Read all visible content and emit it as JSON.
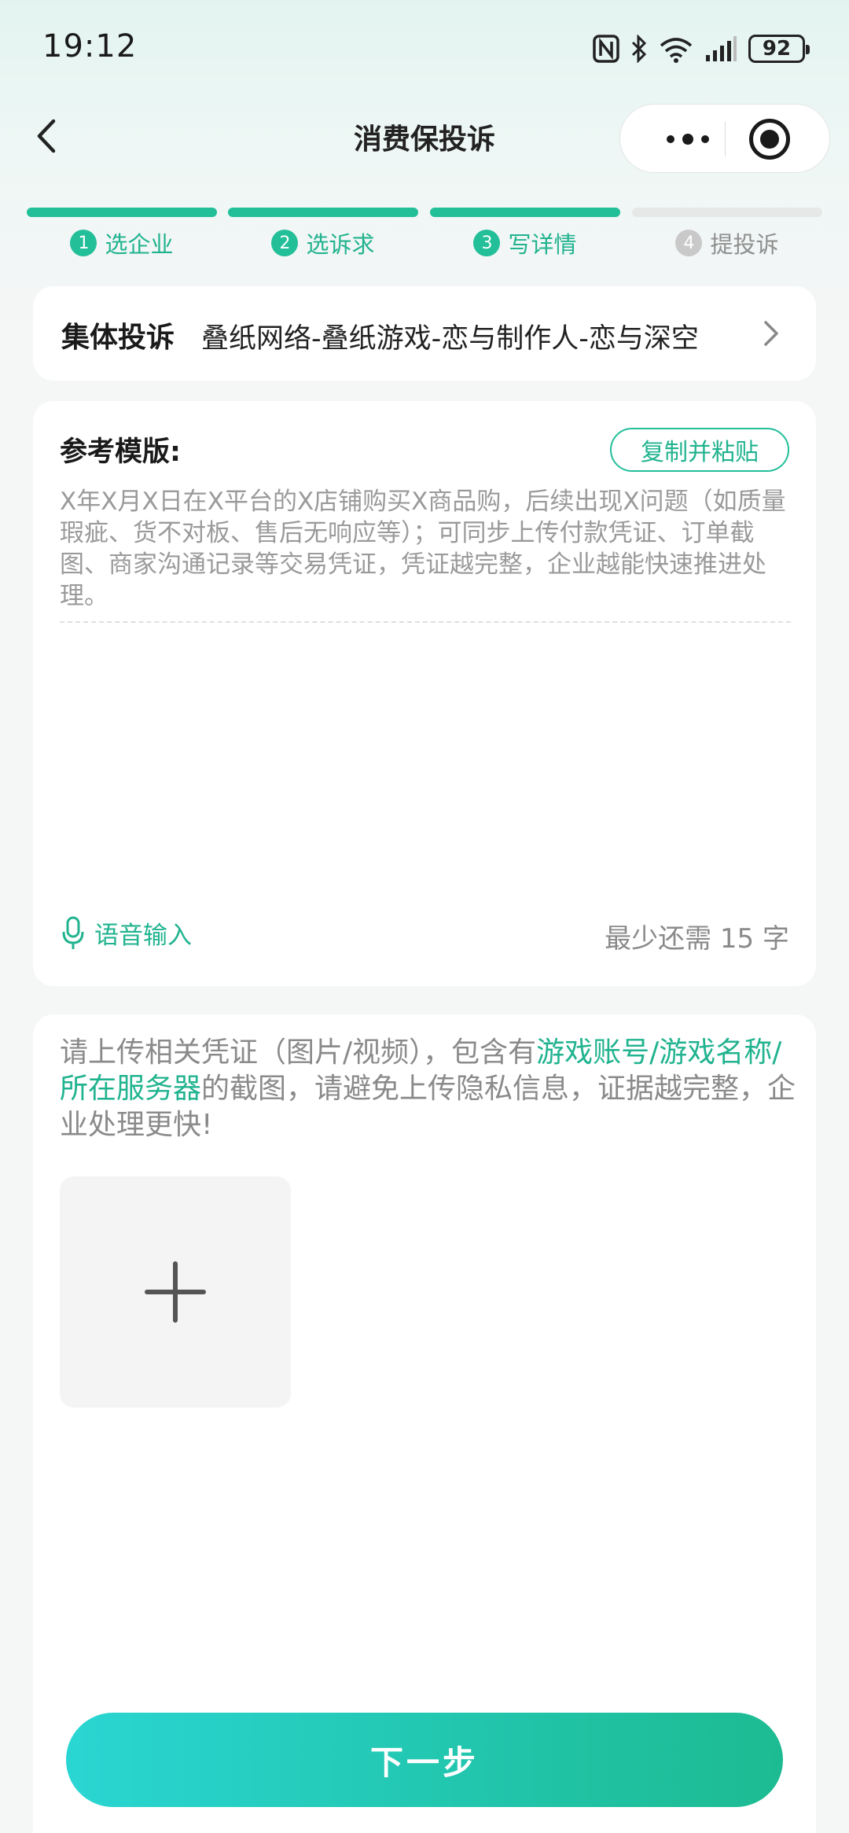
{
  "status_bar": {
    "time": "19:12",
    "battery": "92",
    "icons": [
      "nfc-icon",
      "bluetooth-icon",
      "wifi-icon",
      "signal-icon",
      "battery-icon"
    ]
  },
  "nav": {
    "title": "消费保投诉",
    "back_icon": "chevron-left-icon",
    "more_icon": "more-dots-icon",
    "target_icon": "target-icon"
  },
  "steps": [
    {
      "num": "1",
      "label": "选企业",
      "active": true
    },
    {
      "num": "2",
      "label": "选诉求",
      "active": true
    },
    {
      "num": "3",
      "label": "写详情",
      "active": true
    },
    {
      "num": "4",
      "label": "提投诉",
      "active": false
    }
  ],
  "complaint": {
    "label": "集体投诉",
    "value": "叠纸网络-叠纸游戏-恋与制作人-恋与深空"
  },
  "template": {
    "title": "参考模版:",
    "copy_button": "复制并粘贴",
    "text": "X年X月X日在X平台的X店铺购买X商品购，后续出现X问题（如质量瑕疵、货不对板、售后无响应等）；可同步上传付款凭证、订单截图、商家沟通记录等交易凭证，凭证越完整，企业越能快速推进处理。",
    "voice_label": "语音输入",
    "counter": "最少还需 15 字"
  },
  "upload": {
    "text_before": "请上传相关凭证（图片/视频），包含有",
    "text_highlight": "游戏账号/游戏名称/所在服务器",
    "text_after": "的截图，请避免上传隐私信息，证据越完整，企业处理更快!",
    "add_icon": "plus-icon"
  },
  "footer": {
    "next_button": "下一步"
  },
  "colors": {
    "accent": "#22bf99",
    "accent_text": "#21b38f",
    "button_gradient_start": "#2ad6d3",
    "button_gradient_end": "#1dbb92"
  }
}
